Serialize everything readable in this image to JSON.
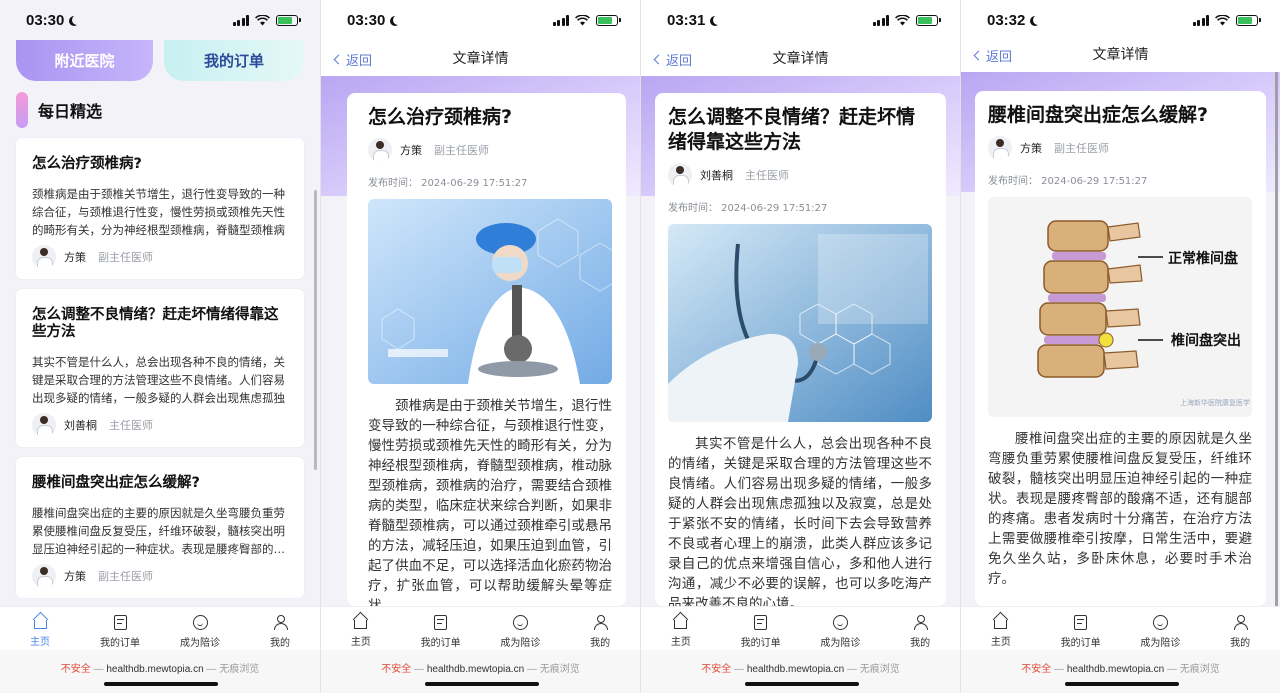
{
  "screens": [
    {
      "time": "03:30",
      "home": {
        "btn_hospital": "附近医院",
        "btn_orders": "我的订单",
        "section_title": "每日精选",
        "cards": [
          {
            "title": "怎么治疗颈椎病?",
            "summary": "颈椎病是由于颈椎关节增生，退行性变导致的一种综合征，与颈椎退行性变，慢性劳损或颈椎先天性的畸形有关，分为神经根型颈椎病，脊髓型颈椎病",
            "doctor": "方策",
            "doctor_title": "副主任医师"
          },
          {
            "title": "怎么调整不良情绪？赶走坏情绪得靠这些方法",
            "summary": "其实不管是什么人，总会出现各种不良的情绪，关键是采取合理的方法管理这些不良情绪。人们容易出现多疑的情绪，一般多疑的人群会出现焦虑孤独",
            "doctor": "刘善桐",
            "doctor_title": "主任医师"
          },
          {
            "title": "腰椎间盘突出症怎么缓解?",
            "summary": "腰椎间盘突出症的主要的原因就是久坐弯腰负重劳累使腰椎间盘反复受压，纤维环破裂，髓核突出明显压迫神经引起的一种症状。表现是腰疼臀部的酸痛不适",
            "doctor": "方策",
            "doctor_title": "副主任医师"
          }
        ]
      }
    },
    {
      "time": "03:30",
      "back": "返回",
      "nav_title": "文章详情",
      "article": {
        "title": "怎么治疗颈椎病?",
        "doctor": "方策",
        "doctor_title": "副主任医师",
        "published": "发布时间： 2024-06-29 17:51:27",
        "body": "颈椎病是由于颈椎关节增生，退行性变导致的一种综合征，与颈椎退行性变，慢性劳损或颈椎先天性的畸形有关，分为神经根型颈椎病，脊髓型颈椎病，椎动脉型颈椎病，颈椎病的治疗，需要结合颈椎病的类型，临床症状来综合判断，如果非脊髓型颈椎病，可以通过颈椎牵引或悬吊的方法，减轻压迫，如果压迫到血管，引起了供血不足，可以选择活血化瘀药物治疗，扩张血管，可以帮助缓解头晕等症状。"
      }
    },
    {
      "time": "03:31",
      "back": "返回",
      "nav_title": "文章详情",
      "article": {
        "title": "怎么调整不良情绪？赶走坏情绪得靠这些方法",
        "doctor": "刘善桐",
        "doctor_title": "主任医师",
        "published": "发布时间： 2024-06-29 17:51:27",
        "body": "其实不管是什么人，总会出现各种不良的情绪，关键是采取合理的方法管理这些不良情绪。人们容易出现多疑的情绪，一般多疑的人群会出现焦虑孤独以及寂寞，总是处于紧张不安的情绪，长时间下去会导致营养不良或者心理上的崩溃，此类人群应该多记录自己的优点来增强自信心，多和他人进行沟通，减少不必要的误解，也可以多吃海产品来改善不良的心境。"
      }
    },
    {
      "time": "03:32",
      "back": "返回",
      "nav_title": "文章详情",
      "article": {
        "title": "腰椎间盘突出症怎么缓解?",
        "doctor": "方策",
        "doctor_title": "副主任医师",
        "published": "发布时间： 2024-06-29 17:51:27",
        "image_label_normal": "正常椎间盘",
        "image_label_herniated": "椎间盘突出",
        "image_watermark": "上海新华医院康复医学",
        "body": "腰椎间盘突出症的主要的原因就是久坐弯腰负重劳累使腰椎间盘反复受压，纤维环破裂，髓核突出明显压迫神经引起的一种症状。表现是腰疼臀部的酸痛不适，还有腿部的疼痛。患者发病时十分痛苦，在治疗方法上需要做腰椎牵引按摩，日常生活中，要避免久坐久站，多卧床休息，必要时手术治疗。"
      }
    }
  ],
  "tabs": [
    "主页",
    "我的订单",
    "成为陪诊",
    "我的"
  ],
  "browser": {
    "warn": "不安全",
    "sep": " — ",
    "host": "healthdb.mewtopia.cn",
    "mode": "无痕浏览"
  },
  "colors": {
    "accent": "#4a86e8",
    "banner": "#b9a6f2",
    "warn": "#e24a3b"
  }
}
